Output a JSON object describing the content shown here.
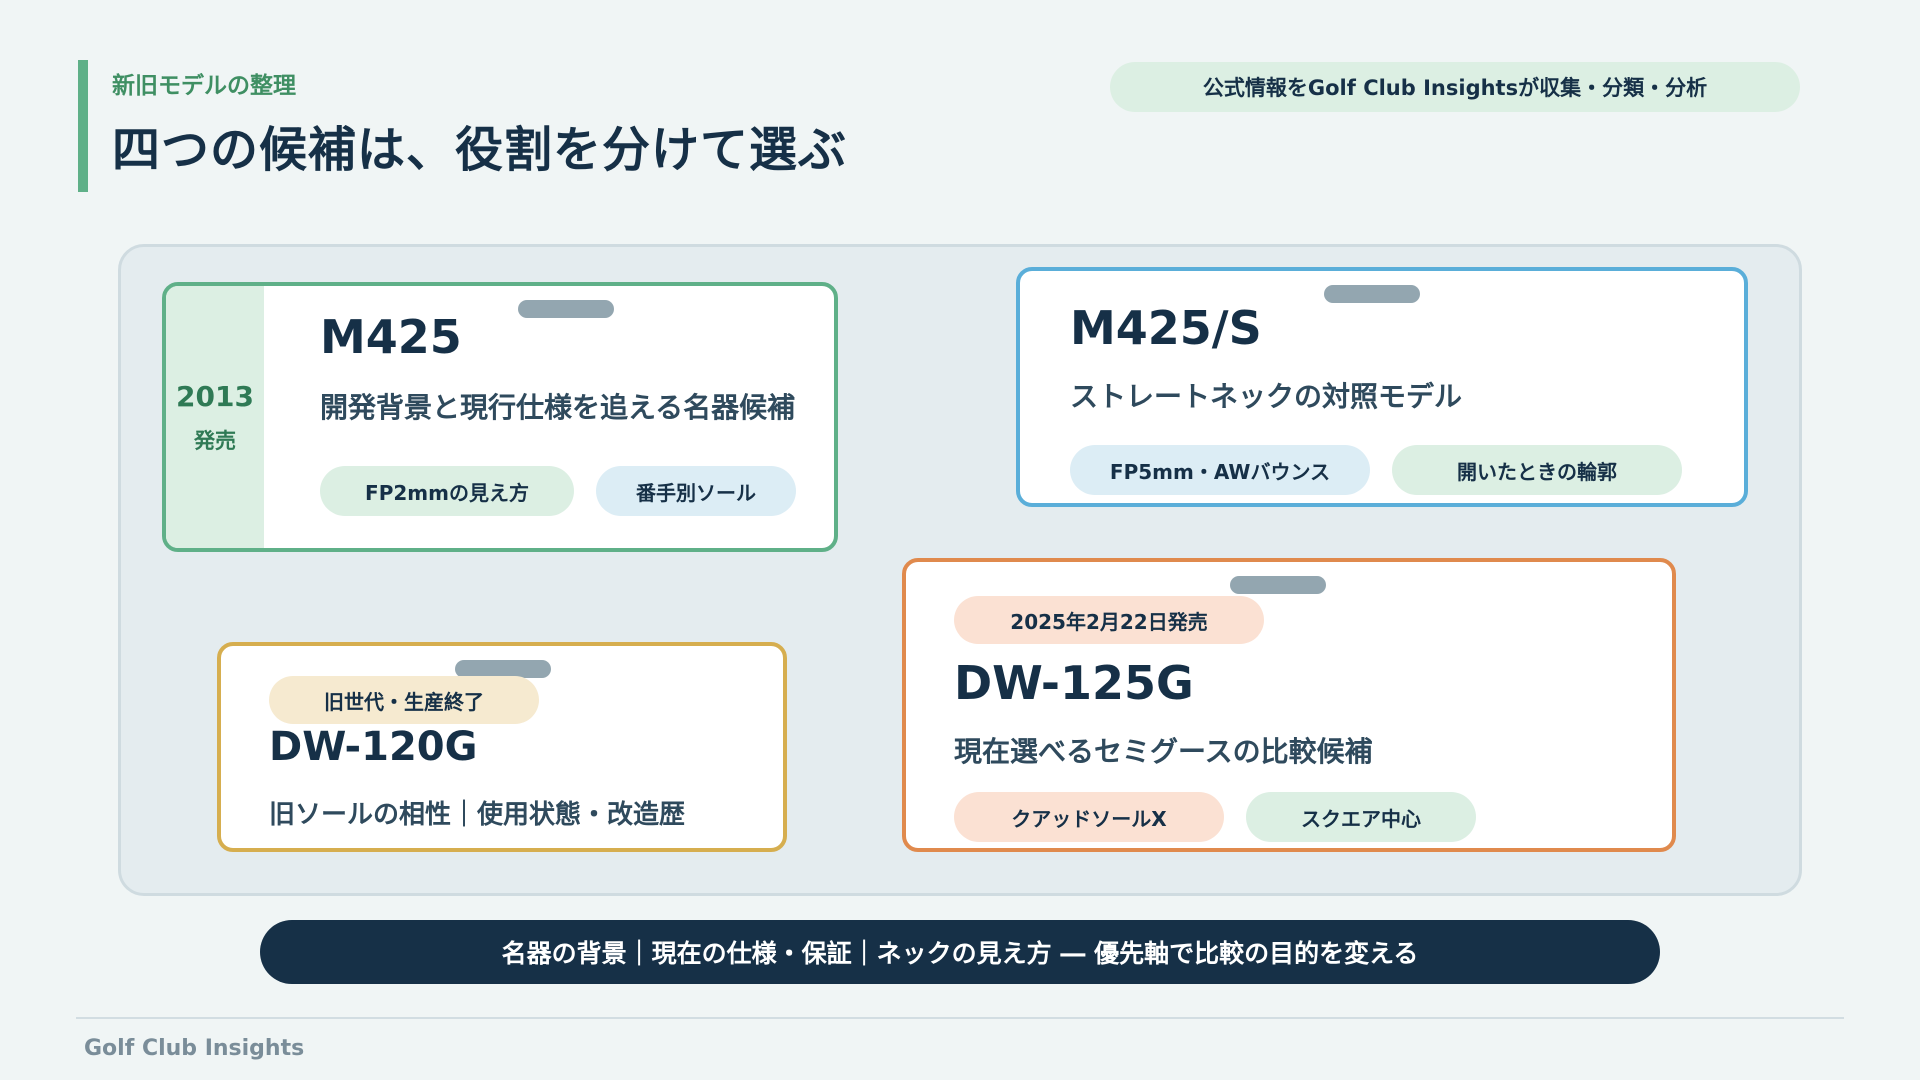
{
  "header": {
    "eyebrow": "新旧モデルの整理",
    "title": "四つの候補は、役割を分けて選ぶ",
    "source_pill": "公式情報をGolf Club Insightsが収集・分類・分析"
  },
  "cards": {
    "m425": {
      "year": "2013",
      "year_label": "発売",
      "model": "M425",
      "description": "開発背景と現行仕様を追える名器候補",
      "tags": [
        "FP2mmの見え方",
        "番手別ソール"
      ]
    },
    "m425s": {
      "model": "M425/S",
      "description": "ストレートネックの対照モデル",
      "tags": [
        "FP5mm・AWバウンス",
        "開いたときの輪郭"
      ]
    },
    "dw120g": {
      "badge": "旧世代・生産終了",
      "model": "DW-120G",
      "description": "旧ソールの相性｜使用状態・改造歴"
    },
    "dw125g": {
      "badge": "2025年2月22日発売",
      "model": "DW-125G",
      "description": "現在選べるセミグースの比較候補",
      "tags": [
        "クアッドソールX",
        "スクエア中心"
      ]
    }
  },
  "summary": "名器の背景｜現在の仕様・保証｜ネックの見え方 ― 優先軸で比較の目的を変える",
  "footer": {
    "brand": "Golf Club Insights"
  },
  "colors": {
    "green": "#5fb088",
    "blue": "#5aaed9",
    "gold": "#d6ae4f",
    "orange": "#e08a4d",
    "navy": "#163047"
  }
}
